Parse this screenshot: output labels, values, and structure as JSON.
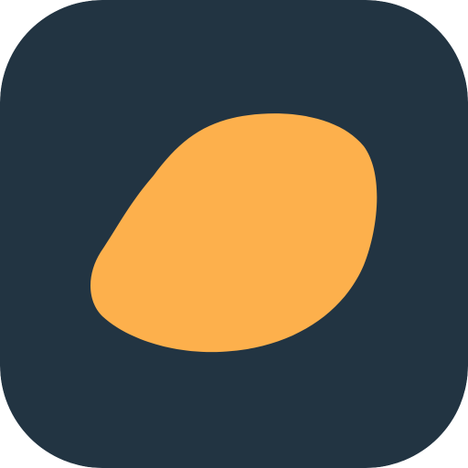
{
  "icon": {
    "name": "mango-app-icon",
    "background_color": "#223442",
    "shape_color": "#FDB04C",
    "glyph": "mango-blob"
  }
}
